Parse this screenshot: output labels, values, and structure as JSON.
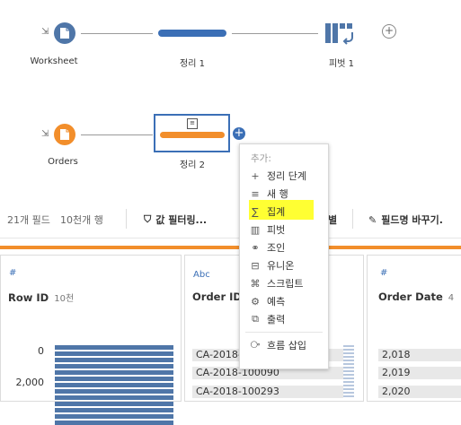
{
  "flow": {
    "nodes": [
      {
        "id": "worksheet",
        "label": "Worksheet"
      },
      {
        "id": "clean1",
        "label": "정리 1"
      },
      {
        "id": "pivot1",
        "label": "피벗 1"
      },
      {
        "id": "orders",
        "label": "Orders"
      },
      {
        "id": "clean2",
        "label": "정리 2"
      }
    ],
    "colors": {
      "blue": "#4f76a8",
      "orange": "#f28e2b",
      "selected": "#3b6fb6"
    }
  },
  "toolbar": {
    "field_count": "21개 필드",
    "row_count": "10천개 행",
    "filter_label": "값 필터링...",
    "hidden_label": "별",
    "rename_label": "필드명 바꾸기."
  },
  "cards": [
    {
      "type": "#",
      "title": "Row ID",
      "sub": "10천",
      "axis": [
        "0",
        "2,000"
      ],
      "bars": [
        100,
        100,
        100,
        100,
        100,
        100,
        100,
        100,
        100,
        100,
        100,
        100,
        100
      ]
    },
    {
      "type": "Abc",
      "title": "Order ID",
      "values": [
        "CA-2018-",
        "CA-2018-100090",
        "CA-2018-100293"
      ]
    },
    {
      "type": "#",
      "title": "Order Date",
      "sub": "4",
      "values": [
        "2,018",
        "2,019",
        "2,020"
      ]
    }
  ],
  "menu": {
    "header": "추가:",
    "items": [
      {
        "icon": "plus-icon",
        "glyph": "+",
        "label": "정리 단계"
      },
      {
        "icon": "new-rows-icon",
        "glyph": "≡",
        "label": "새 행"
      },
      {
        "icon": "sigma-icon",
        "glyph": "∑",
        "label": "집계"
      },
      {
        "icon": "pivot-icon",
        "glyph": "▥",
        "label": "피벗"
      },
      {
        "icon": "join-icon",
        "glyph": "⚭",
        "label": "조인"
      },
      {
        "icon": "union-icon",
        "glyph": "⊟",
        "label": "유니온"
      },
      {
        "icon": "script-icon",
        "glyph": "⌘",
        "label": "스크립트"
      },
      {
        "icon": "predict-icon",
        "glyph": "⚙",
        "label": "예측"
      },
      {
        "icon": "output-icon",
        "glyph": "⧉",
        "label": "출력"
      }
    ],
    "insert": {
      "icon": "insert-flow-icon",
      "glyph": "⧂",
      "label": "흐름 삽입"
    }
  }
}
